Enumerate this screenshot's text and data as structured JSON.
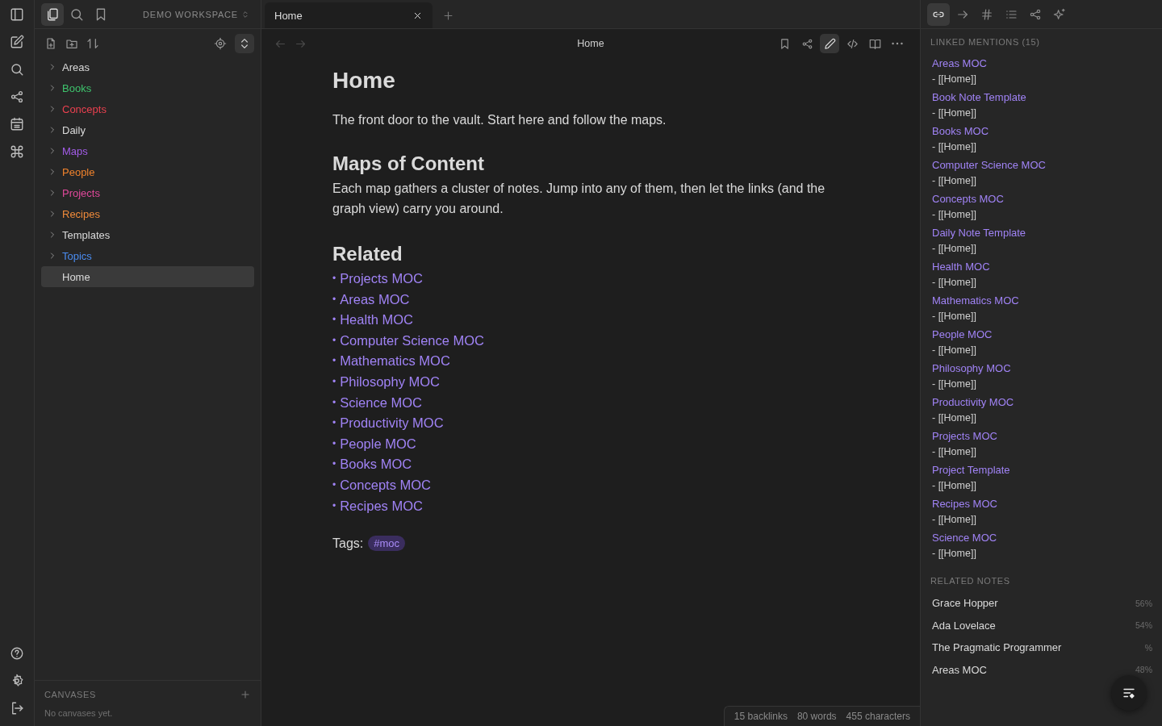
{
  "sidebar": {
    "tabs": [
      {
        "kind": "files",
        "selected": true
      },
      {
        "kind": "search",
        "selected": false
      },
      {
        "kind": "bookmarks",
        "selected": false
      }
    ],
    "workspace": "DEMO WORKSPACE",
    "tree": [
      {
        "kind": "folder",
        "label": "Areas",
        "color": "#dadada",
        "expanded": false,
        "selected": false
      },
      {
        "kind": "folder",
        "label": "Books",
        "color": "#3ec46d",
        "expanded": false,
        "selected": false
      },
      {
        "kind": "folder",
        "label": "Concepts",
        "color": "#e9404f",
        "expanded": false,
        "selected": false
      },
      {
        "kind": "folder",
        "label": "Daily",
        "color": "#dadada",
        "expanded": false,
        "selected": false
      },
      {
        "kind": "folder",
        "label": "Maps",
        "color": "#a35ce8",
        "expanded": false,
        "selected": false
      },
      {
        "kind": "folder",
        "label": "People",
        "color": "#f0822c",
        "expanded": false,
        "selected": false
      },
      {
        "kind": "folder",
        "label": "Projects",
        "color": "#e0489b",
        "expanded": false,
        "selected": false
      },
      {
        "kind": "folder",
        "label": "Recipes",
        "color": "#ef8a3a",
        "expanded": false,
        "selected": false
      },
      {
        "kind": "folder",
        "label": "Templates",
        "color": "#dadada",
        "expanded": false,
        "selected": false
      },
      {
        "kind": "folder",
        "label": "Topics",
        "color": "#4a8cf0",
        "expanded": false,
        "selected": false
      },
      {
        "kind": "file",
        "label": "Home",
        "color": "#dadada",
        "selected": true
      }
    ],
    "canvases": {
      "title": "CANVASES",
      "empty": "No canvases yet."
    }
  },
  "tab": {
    "title": "Home"
  },
  "editor": {
    "title": "Home",
    "toolbar": [
      {
        "kind": "bookmark",
        "selected": false
      },
      {
        "kind": "share",
        "selected": false
      },
      {
        "kind": "edit",
        "selected": true
      },
      {
        "kind": "source",
        "selected": false
      },
      {
        "kind": "reading",
        "selected": false
      },
      {
        "kind": "more",
        "selected": false
      }
    ],
    "heading": "Home",
    "intro": "The front door to the vault. Start here and follow the maps.",
    "maps_heading": "Maps of Content",
    "maps_text": "Each map gathers a cluster of notes. Jump into any of them, then let the links (and the graph view) carry you around.",
    "related_heading": "Related",
    "links": [
      {
        "bullet": "•",
        "text": "Projects MOC"
      },
      {
        "bullet": "•",
        "text": "Areas MOC"
      },
      {
        "bullet": "•",
        "text": "Health MOC"
      },
      {
        "bullet": "•",
        "text": "Computer Science MOC"
      },
      {
        "bullet": "•",
        "text": "Mathematics MOC"
      },
      {
        "bullet": "•",
        "text": "Philosophy MOC"
      },
      {
        "bullet": "•",
        "text": "Science MOC"
      },
      {
        "bullet": "•",
        "text": "Productivity MOC"
      },
      {
        "bullet": "•",
        "text": "People MOC"
      },
      {
        "bullet": "•",
        "text": "Books MOC"
      },
      {
        "bullet": "•",
        "text": "Concepts MOC"
      },
      {
        "bullet": "•",
        "text": "Recipes MOC"
      }
    ],
    "tags_label": "Tags:",
    "tags": [
      "#moc"
    ],
    "status": [
      "15 backlinks",
      "80 words",
      "455 characters"
    ]
  },
  "right_panel": {
    "tabs": [
      {
        "kind": "links",
        "selected": true
      },
      {
        "kind": "outgoing",
        "selected": false
      },
      {
        "kind": "tags",
        "selected": false
      },
      {
        "kind": "outline",
        "selected": false
      },
      {
        "kind": "graph",
        "selected": false
      },
      {
        "kind": "ai",
        "selected": false
      }
    ],
    "mentions_title": "LINKED MENTIONS (15)",
    "mentions": [
      {
        "title": "Areas MOC",
        "context": "- [[Home]]"
      },
      {
        "title": "Book Note Template",
        "context": "- [[Home]]"
      },
      {
        "title": "Books MOC",
        "context": "- [[Home]]"
      },
      {
        "title": "Computer Science MOC",
        "context": "- [[Home]]"
      },
      {
        "title": "Concepts MOC",
        "context": "- [[Home]]"
      },
      {
        "title": "Daily Note Template",
        "context": "- [[Home]]"
      },
      {
        "title": "Health MOC",
        "context": "- [[Home]]"
      },
      {
        "title": "Mathematics MOC",
        "context": "- [[Home]]"
      },
      {
        "title": "People MOC",
        "context": "- [[Home]]"
      },
      {
        "title": "Philosophy MOC",
        "context": "- [[Home]]"
      },
      {
        "title": "Productivity MOC",
        "context": "- [[Home]]"
      },
      {
        "title": "Projects MOC",
        "context": "- [[Home]]"
      },
      {
        "title": "Project Template",
        "context": "- [[Home]]"
      },
      {
        "title": "Recipes MOC",
        "context": "- [[Home]]"
      },
      {
        "title": "Science MOC",
        "context": "- [[Home]]"
      }
    ],
    "related_title": "RELATED NOTES",
    "related": [
      {
        "title": "Grace Hopper",
        "score": "56%"
      },
      {
        "title": "Ada Lovelace",
        "score": "54%"
      },
      {
        "title": "The Pragmatic Programmer",
        "score": "%"
      },
      {
        "title": "Areas MOC",
        "score": "48%"
      }
    ]
  }
}
